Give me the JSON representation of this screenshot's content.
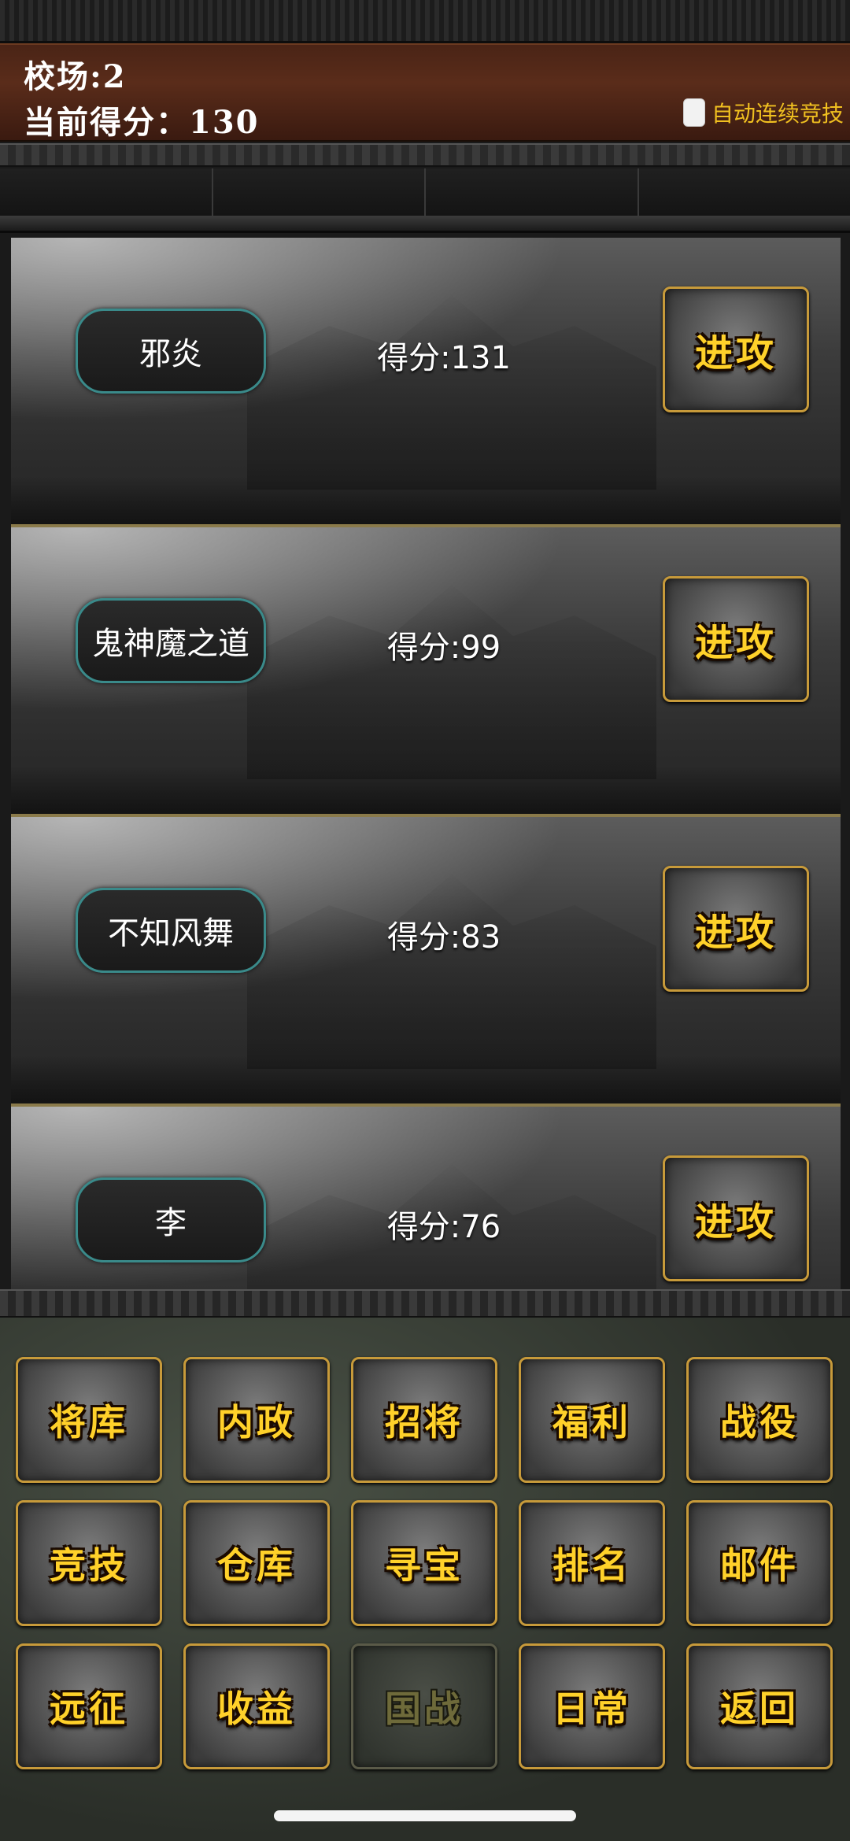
{
  "header": {
    "arena_label": "校场:",
    "arena_value": "2",
    "score_label": "当前得分：",
    "score_value": "130",
    "auto_toggle_label": "自动连续竞技"
  },
  "opponents": [
    {
      "name": "邪炎",
      "score": "得分:131",
      "attack_label": "进攻"
    },
    {
      "name": "鬼神魔之道",
      "score": "得分:99",
      "attack_label": "进攻"
    },
    {
      "name": "不知风舞",
      "score": "得分:83",
      "attack_label": "进攻"
    },
    {
      "name": "李",
      "score": "得分:76",
      "attack_label": "进攻"
    }
  ],
  "menu": [
    {
      "label": "将库",
      "enabled": true
    },
    {
      "label": "内政",
      "enabled": true
    },
    {
      "label": "招将",
      "enabled": true
    },
    {
      "label": "福利",
      "enabled": true
    },
    {
      "label": "战役",
      "enabled": true
    },
    {
      "label": "竞技",
      "enabled": true
    },
    {
      "label": "仓库",
      "enabled": true
    },
    {
      "label": "寻宝",
      "enabled": true
    },
    {
      "label": "排名",
      "enabled": true
    },
    {
      "label": "邮件",
      "enabled": true
    },
    {
      "label": "远征",
      "enabled": true
    },
    {
      "label": "收益",
      "enabled": true
    },
    {
      "label": "国战",
      "enabled": false
    },
    {
      "label": "日常",
      "enabled": true
    },
    {
      "label": "返回",
      "enabled": true
    }
  ],
  "colors": {
    "header_bg": "#5a2c1a",
    "gold_text": "#ffd12a",
    "button_border": "#c79a3a",
    "name_pill_border": "#3a8a8a",
    "auto_label": "#f0c020"
  }
}
